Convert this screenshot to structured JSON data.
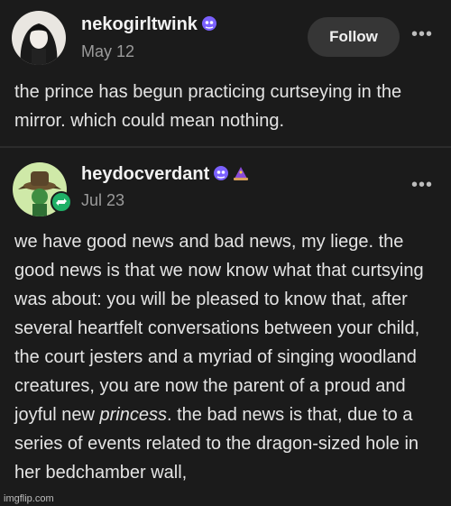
{
  "post1": {
    "username": "nekogirltwink",
    "date": "May 12",
    "follow_label": "Follow",
    "more_label": "•••",
    "text": "the prince has begun practicing curtseying in the mirror. which could mean nothing."
  },
  "post2": {
    "username": "heydocverdant",
    "date": "Jul 23",
    "more_label": "•••",
    "text_before": "we have good news and bad news, my liege. the good news is that we now know what that curtsying was about: you will be pleased to know that, after several heartfelt conversations between your child, the court jesters and a myriad of singing woodland creatures, you are now the parent of a proud and joyful new ",
    "text_em": "princess",
    "text_after": ". the bad news is that, due to a series of events related to the dragon-sized hole in her bedchamber wall,"
  },
  "watermark": "imgflip.com",
  "colors": {
    "background": "#1b1b1b",
    "follow_button": "#363636",
    "reblog_green": "#1fb067",
    "badge_purple": "#7b61ff"
  },
  "icons": {
    "badge": "purple-ghost-badge-icon",
    "hat_badge": "wizard-hat-badge-icon",
    "reblog": "reblog-icon",
    "more": "more-dots-icon"
  }
}
